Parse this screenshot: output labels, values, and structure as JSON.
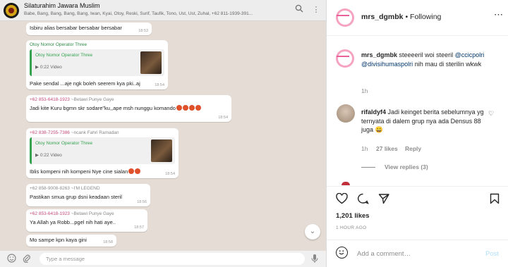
{
  "whatsapp": {
    "group_name": "Silaturahim Jawara Muslim",
    "members": "Babe, Bang, Bang, Bang, Bang, Iwan, Kyai, Otoy, Reski, Surif, Taufik, Tono, Ust, Ust, Zuhal, +62 811-1939-391...",
    "messages": [
      {
        "text": "Isbiru alias bersabar bersabar bersabar",
        "time": "18:53"
      },
      {
        "sender_green": "Otoy Nomor Operator Three",
        "quote_name": "Otoy Nomor Operator Three",
        "quote_meta": "0:22 Video",
        "text": "Pake sendal ...aje ngk boleh seerem kya pki..aj",
        "time": "18:54"
      },
      {
        "sender": "+62 853-6418-1923",
        "sender_sub": "~Betawi Punye Gaye",
        "text": "Jadi kite Kuru bgmn skr sodare\"ku,,ape msh nunggu komando",
        "time": "18:54"
      },
      {
        "sender": "+62 838-7255-7386",
        "sender_sub": "~ncank Fahri Ramadan",
        "quote_name": "Otoy Nomor Operator Three",
        "quote_meta": "0:22 Video",
        "text": "Iblis kompeni nih kompeni Nye cine sialan",
        "time": "18:54"
      },
      {
        "sender": "+62 858-9008-8263",
        "sender_sub": "~I'M LEGEND",
        "text": "Pastikan smua grup dsni keadaan steril",
        "time": "18:56"
      },
      {
        "sender": "+62 853-6418-1923",
        "sender_sub": "~Betawi Punye Gaye",
        "text": "Ya Allah ya Robb...pgel nih hati aye..",
        "time": "18:57"
      },
      {
        "text": "Mo sampe kpn kaya gini",
        "time": "18:58"
      }
    ],
    "input_placeholder": "Type a message"
  },
  "instagram": {
    "username": "mrs_dgmbk",
    "following": "Following",
    "caption_user": "mrs_dgmbk",
    "caption_text": "steeeeril woi steeril",
    "caption_tag1": "@ccicpolri",
    "caption_tag2": "@divisihumaspolri",
    "caption_tail": "nih mau di sterilin wkwk",
    "caption_time": "1h",
    "comment_user": "rifaldyf4",
    "comment_text": "Jadi keinget berita sebelumnya yg ternyata di dalem grup nya ada Densus 88 juga 😀",
    "comment_time": "1h",
    "comment_likes": "27 likes",
    "comment_reply": "Reply",
    "view_replies": "View replies (3)",
    "likes": "1,201 likes",
    "posted_ago": "1 HOUR AGO",
    "add_comment": "Add a comment…",
    "post_label": "Post"
  }
}
